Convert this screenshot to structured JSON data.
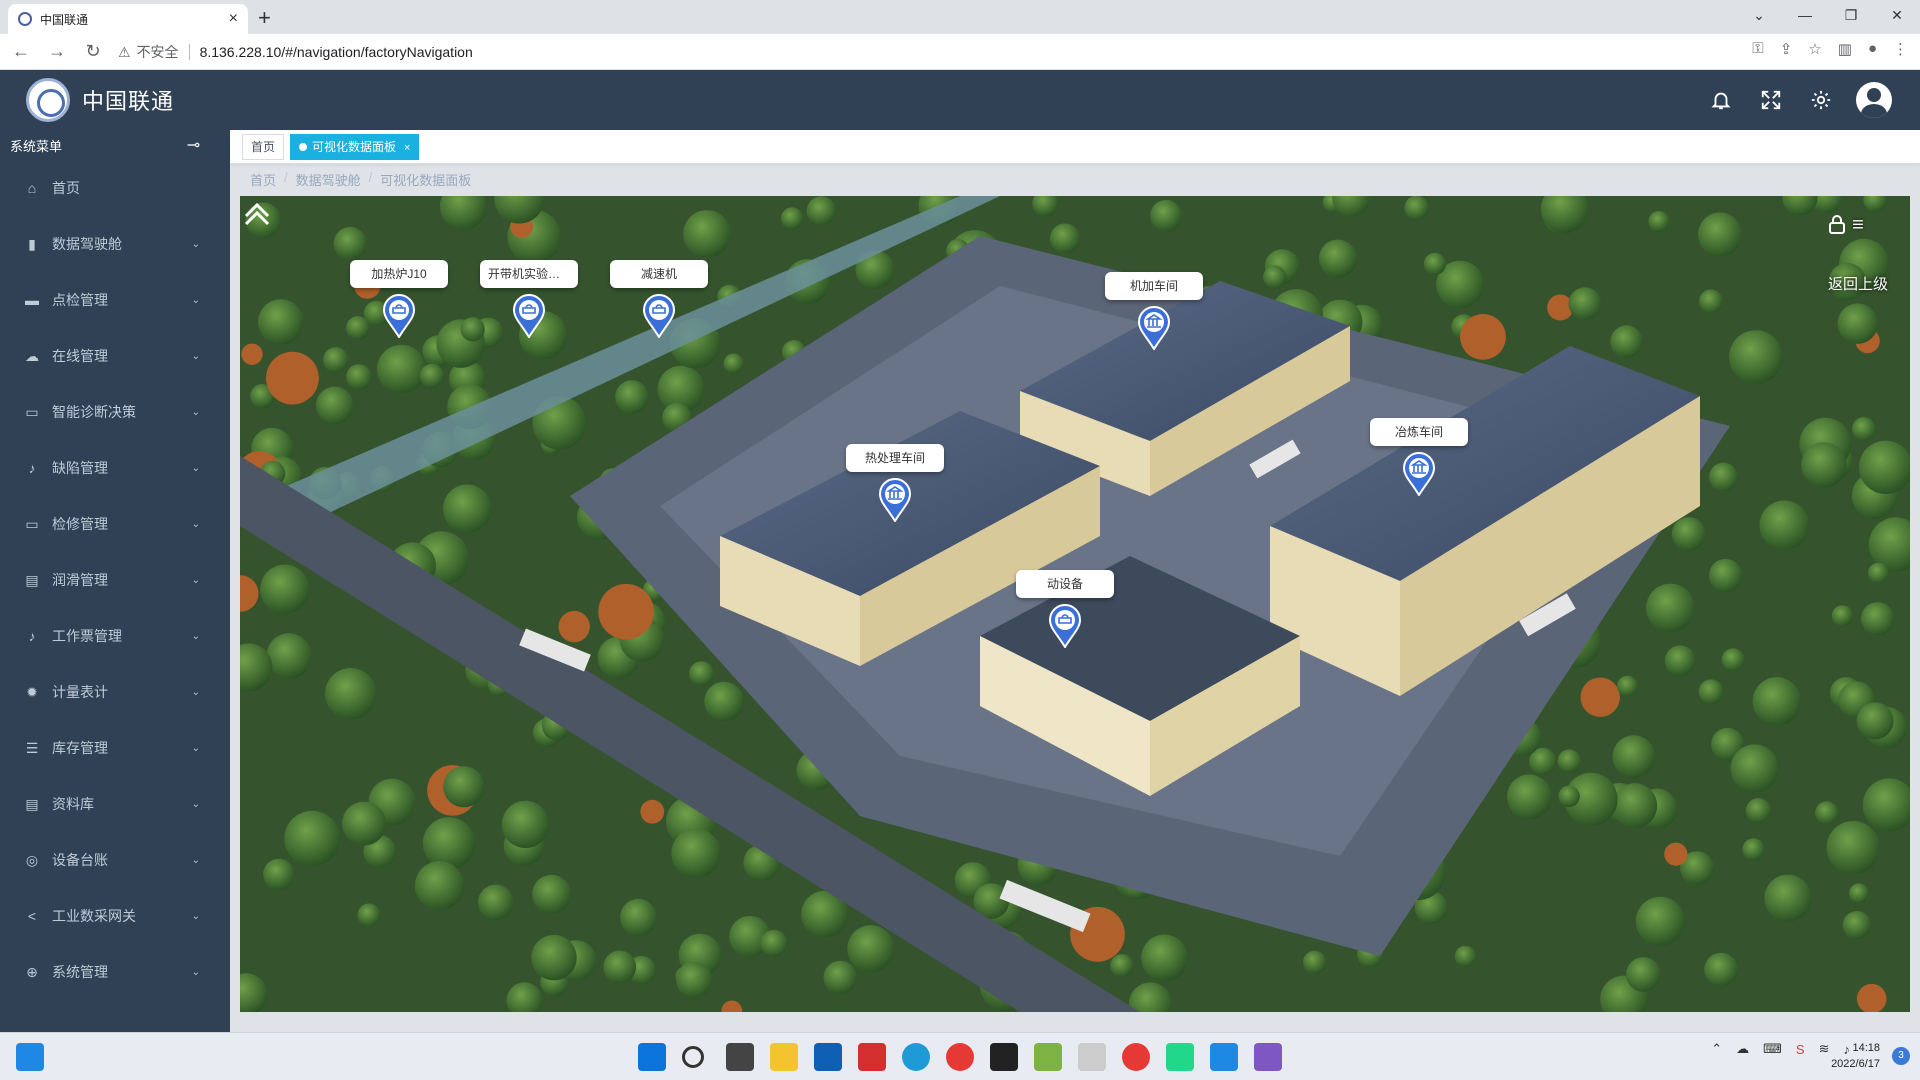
{
  "browser": {
    "tab_title": "中国联通",
    "tab_close": "×",
    "new_tab": "+",
    "insecure_label": "不安全",
    "url": "8.136.228.10/#/navigation/factoryNavigation",
    "window_controls": [
      "⌄",
      "—",
      "❐",
      "✕"
    ]
  },
  "app": {
    "title": "中国联通"
  },
  "sidebar": {
    "header": "系统菜单",
    "items": [
      {
        "label": "首页",
        "icon": "home-icon"
      },
      {
        "label": "数据驾驶舱",
        "icon": "chart-icon"
      },
      {
        "label": "点检管理",
        "icon": "inbox-icon"
      },
      {
        "label": "在线管理",
        "icon": "cloud-icon"
      },
      {
        "label": "智能诊断决策",
        "icon": "monitor-icon"
      },
      {
        "label": "缺陷管理",
        "icon": "bell-icon"
      },
      {
        "label": "检修管理",
        "icon": "monitor-icon"
      },
      {
        "label": "润滑管理",
        "icon": "document-icon"
      },
      {
        "label": "工作票管理",
        "icon": "bell-icon"
      },
      {
        "label": "计量表计",
        "icon": "gear-icon"
      },
      {
        "label": "库存管理",
        "icon": "sliders-icon"
      },
      {
        "label": "资料库",
        "icon": "document-icon"
      },
      {
        "label": "设备台账",
        "icon": "settings-icon"
      },
      {
        "label": "工业数采网关",
        "icon": "share-icon"
      },
      {
        "label": "系统管理",
        "icon": "plus-circle-icon"
      }
    ]
  },
  "tags": {
    "home": "首页",
    "active": "可视化数据面板",
    "close": "×"
  },
  "breadcrumb": [
    "首页",
    "数据驾驶舱",
    "可视化数据面板"
  ],
  "breadcrumb_sep": "/",
  "markers": [
    {
      "label": "加热炉J10",
      "type": "device"
    },
    {
      "label": "开带机实验设备高...",
      "type": "device"
    },
    {
      "label": "减速机",
      "type": "device"
    },
    {
      "label": "机加车间",
      "type": "building"
    },
    {
      "label": "热处理车间",
      "type": "building"
    },
    {
      "label": "冶炼车间",
      "type": "building"
    },
    {
      "label": "动设备",
      "type": "device"
    }
  ],
  "scene_controls": {
    "menu_icon": "≡",
    "lock_icon": "lock-icon",
    "back_label": "返回上级"
  },
  "taskbar": {
    "time": "14:18",
    "date": "2022/6/17",
    "notifications": "3"
  },
  "colors": {
    "header": "#304156",
    "sidebar": "#304156",
    "accent": "#1ab0e0",
    "pin": "#3b6fd8"
  }
}
